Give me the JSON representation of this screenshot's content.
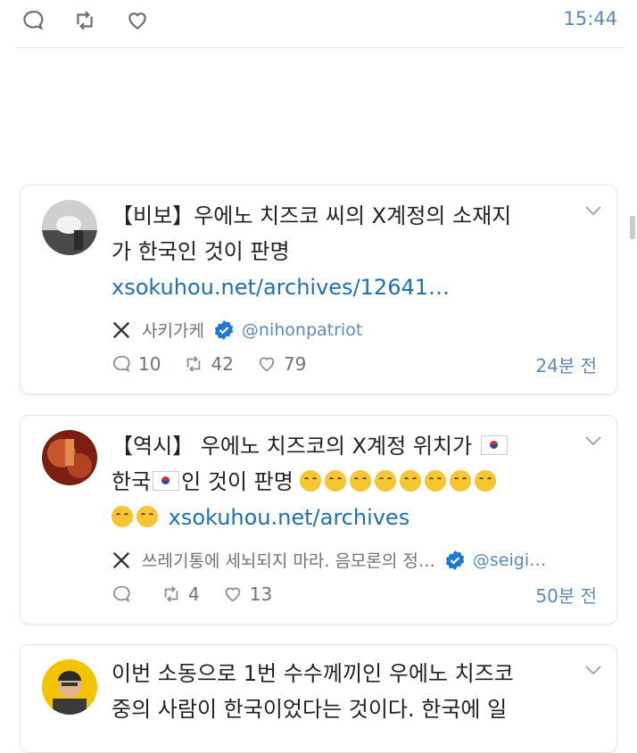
{
  "status": {
    "time": "15:44"
  },
  "posts": [
    {
      "lines": [
        "【비보】우에노 치즈코 씨의 X계정의 소재지",
        "가 한국인 것이 판명"
      ],
      "link": "xsokuhou.net/archives/12641…",
      "source": {
        "name": "사키가케",
        "handle": "@nihonpatriot"
      },
      "stats": {
        "replies": "10",
        "reposts": "42",
        "likes": "79",
        "time_ago": "24분 전"
      }
    },
    {
      "line1": "【역시】 우에노 치즈코의 X계정 위치가",
      "line2a": "한국",
      "line2b": "인 것이 판명",
      "link": "xsokuhou.net/archives",
      "source": {
        "name": "쓰레기통에 세뇌되지 마라. 음모론의 정…",
        "handle": "@seigi…"
      },
      "stats": {
        "replies": "",
        "reposts": "4",
        "likes": "13",
        "time_ago": "50분 전"
      }
    },
    {
      "lines": [
        "이번 소동으로 1번 수수께끼인 우에노 치즈코",
        "중의 사람이 한국이었다는 것이다. 한국에 일"
      ]
    }
  ]
}
